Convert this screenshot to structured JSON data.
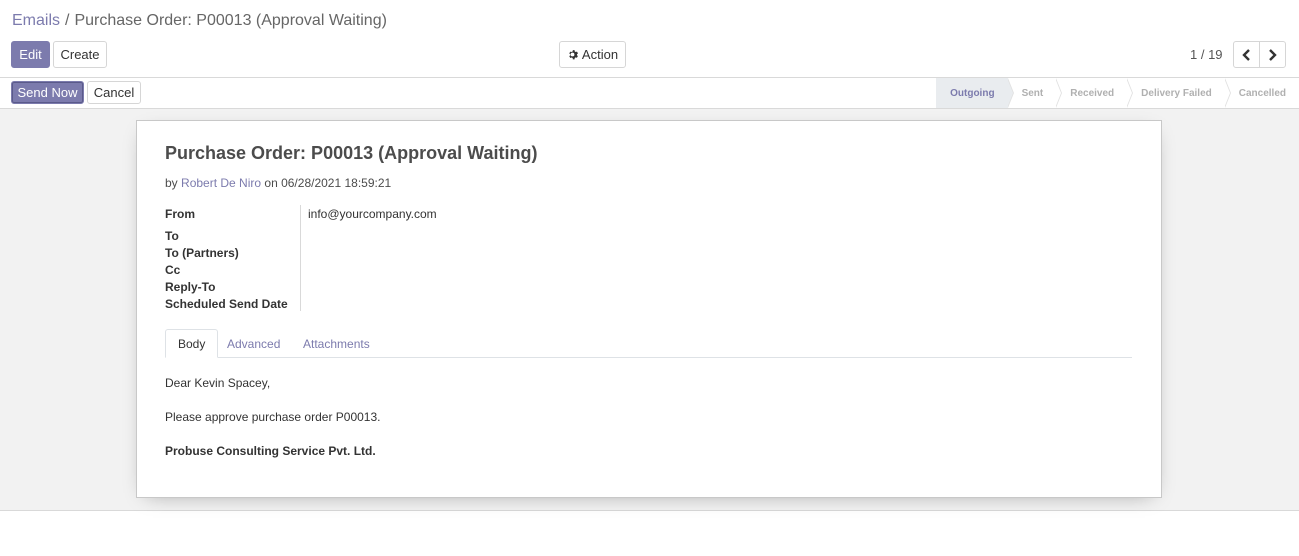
{
  "breadcrumb": {
    "parent": "Emails",
    "separator": "/",
    "current": "Purchase Order: P00013 (Approval Waiting)"
  },
  "toolbar": {
    "edit_label": "Edit",
    "create_label": "Create",
    "action_label": "Action",
    "action_icon": "gear-icon"
  },
  "pager": {
    "value": "1 / 19",
    "prev_icon": "chevron-left-icon",
    "next_icon": "chevron-right-icon"
  },
  "statusbar": {
    "send_now_label": "Send Now",
    "cancel_label": "Cancel",
    "stages": [
      {
        "label": "Outgoing",
        "active": true
      },
      {
        "label": "Sent",
        "active": false
      },
      {
        "label": "Received",
        "active": false
      },
      {
        "label": "Delivery Failed",
        "active": false
      },
      {
        "label": "Cancelled",
        "active": false
      }
    ]
  },
  "record": {
    "title": "Purchase Order: P00013 (Approval Waiting)",
    "meta_by": "by",
    "author": "Robert De Niro",
    "meta_on": "on 06/28/2021 18:59:21",
    "fields": [
      {
        "label": "From",
        "value": "info@yourcompany.com"
      },
      {
        "label": "To",
        "value": ""
      },
      {
        "label": "To (Partners)",
        "value": ""
      },
      {
        "label": "Cc",
        "value": ""
      },
      {
        "label": "Reply-To",
        "value": ""
      },
      {
        "label": "Scheduled Send Date",
        "value": ""
      }
    ],
    "tabs": [
      {
        "label": "Body",
        "active": true
      },
      {
        "label": "Advanced",
        "active": false
      },
      {
        "label": "Attachments",
        "active": false
      }
    ],
    "body": {
      "greeting": "Dear Kevin Spacey,",
      "message": "Please approve purchase order P00013.",
      "signature": "Probuse Consulting Service Pvt. Ltd."
    }
  },
  "colors": {
    "accent": "#7c7bad",
    "active_stage_bg": "#e9ecef",
    "background": "#f2f2f2"
  }
}
